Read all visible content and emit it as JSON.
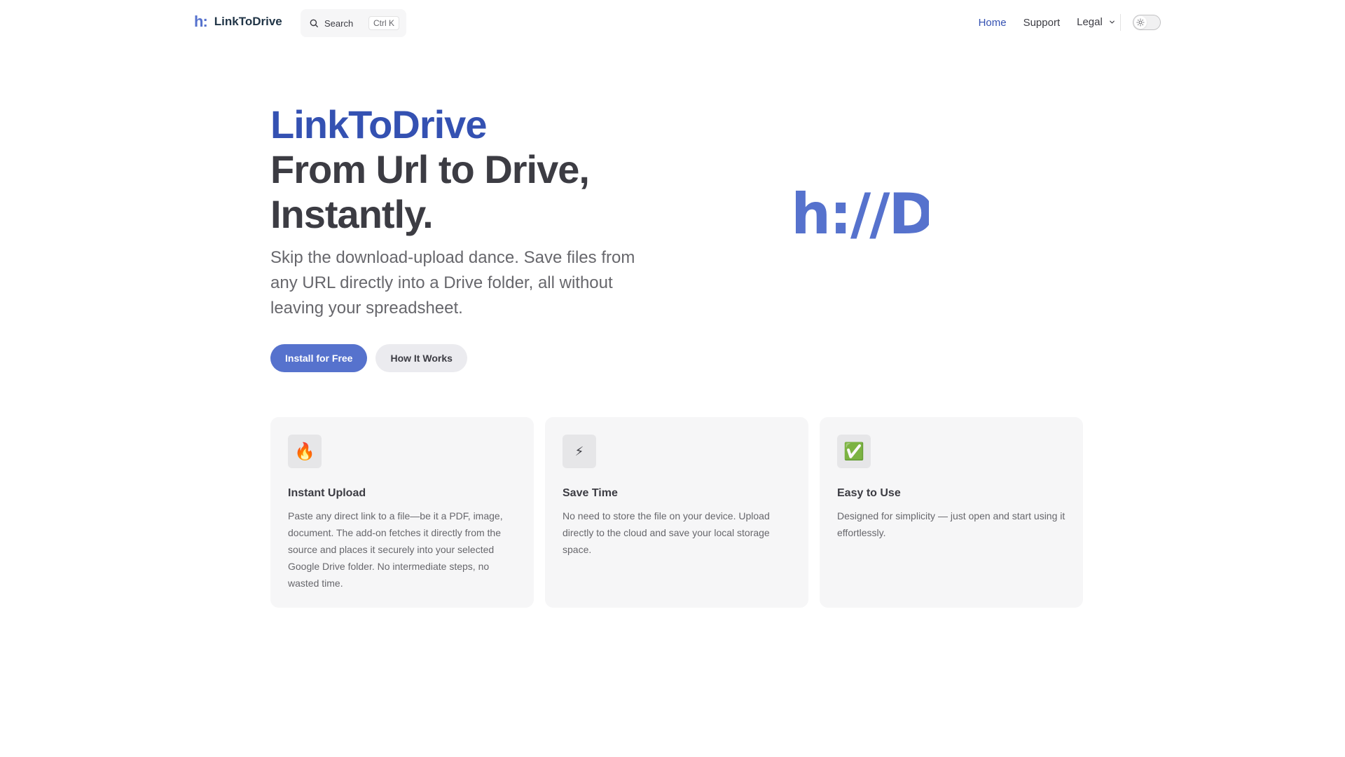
{
  "nav": {
    "logo_mark": "h:",
    "site_title": "LinkToDrive",
    "search_label": "Search",
    "search_shortcut": "Ctrl K",
    "links": [
      {
        "label": "Home",
        "active": true
      },
      {
        "label": "Support",
        "active": false
      },
      {
        "label": "Legal",
        "active": false,
        "has_dropdown": true
      }
    ],
    "theme_toggle_icon": "sun-icon"
  },
  "hero": {
    "name": "LinkToDrive",
    "title_line1": "From Url to Drive,",
    "title_line2": "Instantly.",
    "tagline": "Skip the download-upload dance. Save files from any URL directly into a Drive folder, all without leaving your spreadsheet.",
    "actions": [
      {
        "label": "Install for Free",
        "theme": "brand"
      },
      {
        "label": "How It Works",
        "theme": "alt"
      }
    ],
    "image_text": "h://D"
  },
  "features": [
    {
      "icon": "🔥",
      "icon_name": "fire-icon",
      "title": "Instant Upload",
      "details": "Paste any direct link to a file—be it a PDF, image, document. The add-on fetches it directly from the source and places it securely into your selected Google Drive folder. No intermediate steps, no wasted time."
    },
    {
      "icon": "⚡",
      "icon_name": "lightning-icon",
      "title": "Save Time",
      "details": "No need to store the file on your device. Upload directly to the cloud and save your local storage space."
    },
    {
      "icon": "✅",
      "icon_name": "check-mark-icon",
      "title": "Easy to Use",
      "details": "Designed for simplicity — just open and start using it effortlessly."
    }
  ],
  "colors": {
    "brand": "#5672cd",
    "brand_text": "#3451b2",
    "text_primary": "#3c3c43",
    "text_secondary": "#67676c",
    "card_bg": "#f6f6f7"
  }
}
